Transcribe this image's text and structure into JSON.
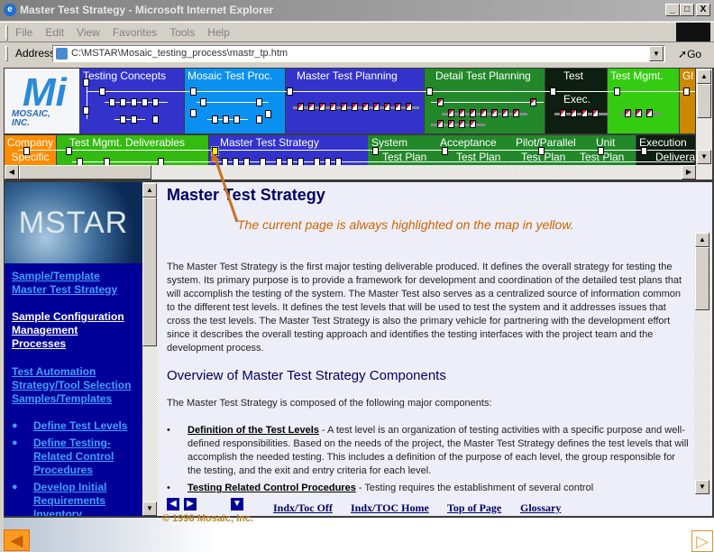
{
  "window": {
    "title": "Master Test Strategy - Microsoft Internet Explorer",
    "minimize": "_",
    "maximize": "□",
    "close": "X"
  },
  "menu": [
    "File",
    "Edit",
    "View",
    "Favorites",
    "Tools",
    "Help"
  ],
  "address": {
    "label": "Address",
    "value": "C:\\MSTAR\\Mosaic_testing_process\\mastr_tp.htm",
    "go": "Go"
  },
  "map": {
    "logo": {
      "text": "MOSAIC, INC.",
      "mark": "Mi"
    },
    "row1": [
      {
        "label": "Testing Concepts",
        "color": "#3333cc"
      },
      {
        "label": "Mosaic Test Proc.",
        "color": "#0a90f0"
      },
      {
        "label": "Master Test Planning",
        "color": "#3333cc"
      },
      {
        "label": "Detail Test Planning",
        "color": "#22882a"
      },
      {
        "label": "Test",
        "sub": "Exec.",
        "color": "#0e1e10"
      },
      {
        "label": "Test Mgmt.",
        "color": "#33cc11"
      },
      {
        "label": "Gl",
        "color": "#cc8800"
      }
    ],
    "row2": [
      {
        "label": "Company",
        "sub": "Specific",
        "color": "#ff8c00"
      },
      {
        "label": "Test Mgmt. Deliverables",
        "color": "#33bb11"
      },
      {
        "label": "Master Test Strategy",
        "color": "#3333cc",
        "current": true
      },
      {
        "label": "System",
        "sub": "Test Plan",
        "color": "#22882a"
      },
      {
        "label": "Acceptance",
        "sub": "Test Plan",
        "color": "#22882a"
      },
      {
        "label": "Pilot/Parallel",
        "sub": "Test Plan",
        "color": "#22882a"
      },
      {
        "label": "Unit",
        "sub": "Test Plan",
        "color": "#22882a"
      },
      {
        "label": "Execution",
        "sub": "Delivera",
        "color": "#0e1e10"
      }
    ],
    "highlight_color": "#ffee00"
  },
  "sidebar": {
    "banner": "MSTAR",
    "links": [
      {
        "label": "Sample/Template Master Test Strategy"
      },
      {
        "label": "Sample Configuration Management Processes"
      },
      {
        "label": "Test Automation Strategy/Tool Selection Samples/Templates"
      }
    ],
    "bullets": [
      "Define Test Levels",
      "Define Testing-Related Control Procedures",
      "Develop Initial Requirements Inventory"
    ]
  },
  "content": {
    "title": "Master Test Strategy",
    "annotation": "The current page is always highlighted on the map in yellow.",
    "intro": "The Master Test Strategy is the first major testing deliverable produced.  It defines the overall strategy for testing the system.  Its primary purpose is to provide a framework for development and coordination of the detailed test plans that will accomplish the testing of the system.  The Master Test also serves as a centralized source of information common to the different test levels.  It defines the test levels that will be used to test the system and it addresses issues that cross the test levels.  The Master Test Strategy is also the primary vehicle for partnering with the development effort since it describes the overall testing approach and identifies the testing interfaces with the project team and the development process.",
    "heading": "Overview of Master Test Strategy Components",
    "components_intro": "The Master Test Strategy is composed of the following major components:",
    "components": [
      {
        "name": "Definition of the Test Levels",
        "text": " - A test level is an organization of testing activities with a specific purpose and well-defined responsibilities.  Based on the needs of the project, the Master Test Strategy defines the test levels that will accomplish the needed testing.  This includes a definition of the purpose of each level, the group responsible for the testing, and the exit and entry criteria for each level."
      },
      {
        "name": "Testing Related Control Procedures",
        "text": " - Testing requires the establishment of several control"
      }
    ]
  },
  "footer": {
    "links": [
      "Indx/Toc Off",
      "Indx/TOC Home",
      "Top of Page",
      "Glossary"
    ],
    "copyright": "© 1998 Mosaic, Inc."
  },
  "icons": {
    "prev": "◀",
    "next": "▷",
    "left": "◀",
    "right": "▶",
    "down": "▼"
  }
}
